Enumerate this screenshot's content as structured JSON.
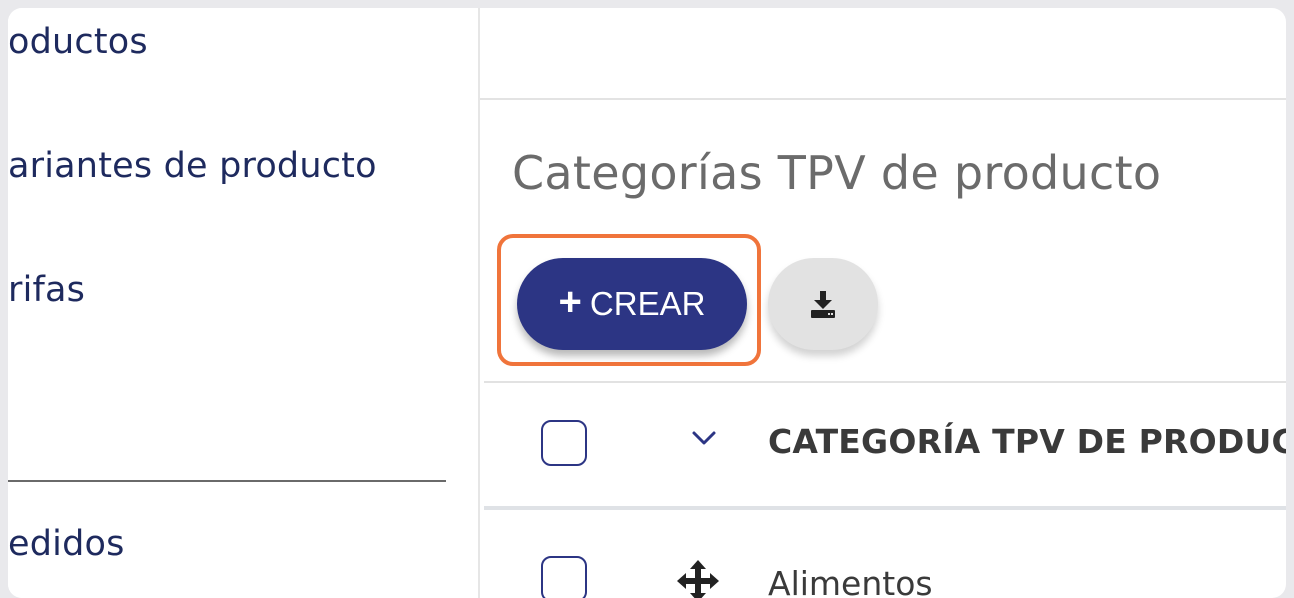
{
  "sidebar": {
    "items": [
      {
        "label": "oductos"
      },
      {
        "label": "ariantes de producto"
      },
      {
        "label": "rifas"
      },
      {
        "label": "edidos"
      }
    ]
  },
  "main": {
    "title": "Categorías TPV de producto",
    "create_button": {
      "label": "CREAR",
      "icon": "plus-icon"
    },
    "download_button": {
      "icon": "download-icon"
    },
    "table": {
      "column_header": "CATEGORÍA TPV DE PRODUCTO",
      "rows": [
        {
          "label": "Alimentos"
        }
      ]
    }
  },
  "colors": {
    "accent": "#2c3584",
    "highlight": "#f0743b",
    "sidebar_text": "#1e2a5e",
    "title_text": "#6b6b6b"
  }
}
